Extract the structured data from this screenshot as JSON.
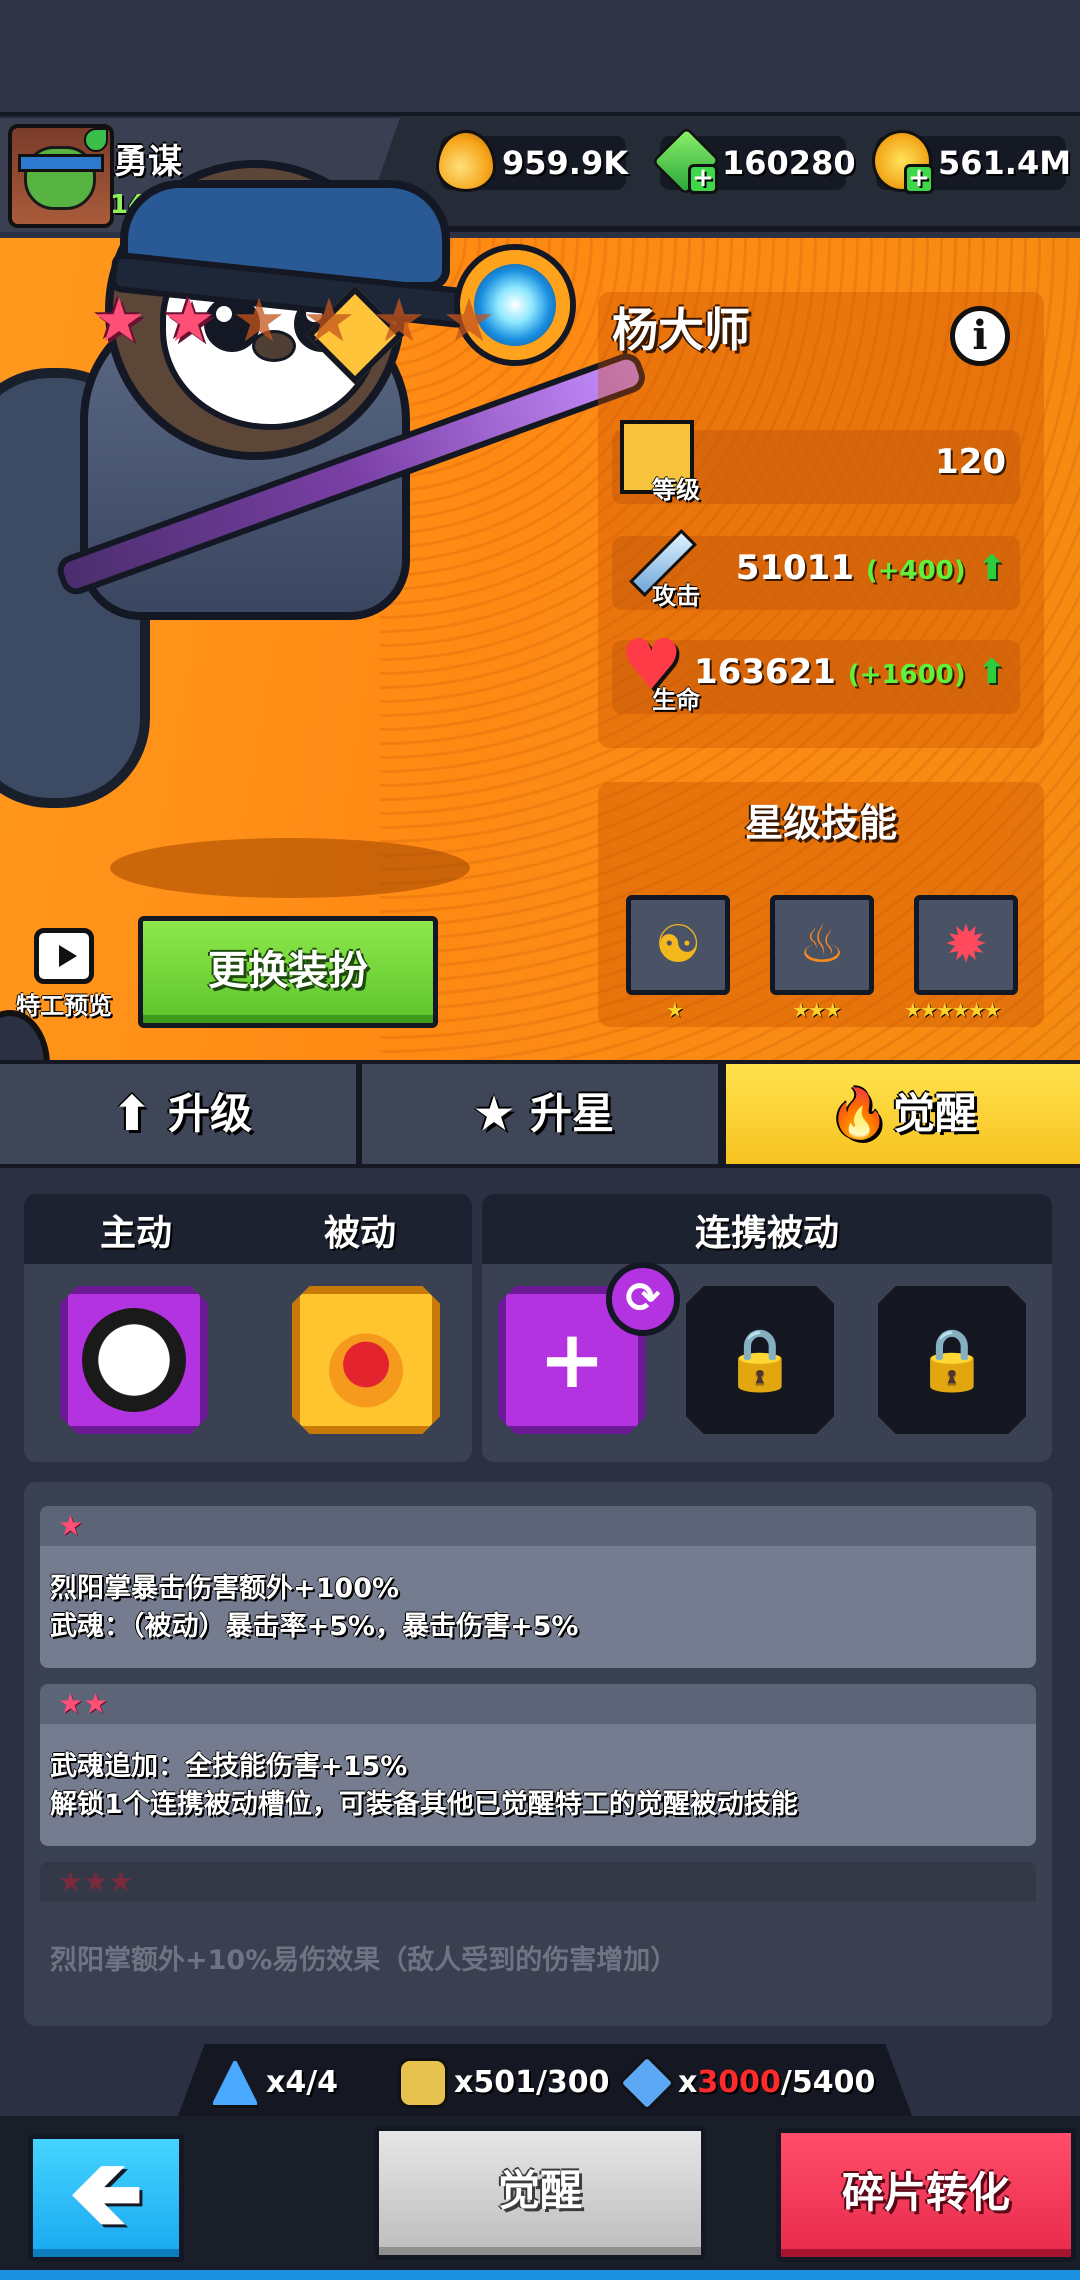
{
  "player": {
    "name": "勇谋",
    "level": "148",
    "xp_fraction": 0.5
  },
  "currencies": {
    "drops": "959.9K",
    "gems": "160280",
    "coins": "561.4M"
  },
  "hero": {
    "name": "杨大师",
    "stars_on": 2,
    "stars_total": 7,
    "stats": {
      "level_label": "等级",
      "level_value": "120",
      "attack_label": "攻击",
      "attack_value": "51011",
      "attack_bonus": "(+400)",
      "hp_label": "生命",
      "hp_value": "163621",
      "hp_bonus": "(+1600)"
    },
    "star_skills_title": "星级技能",
    "star_skills": [
      {
        "icon": "yin-yang-icon",
        "stars": "★"
      },
      {
        "icon": "fire-gourd-icon",
        "stars": "★★★"
      },
      {
        "icon": "fire-beast-icon",
        "stars": "★★★★★★"
      }
    ],
    "preview_label": "特工预览",
    "change_outfit_label": "更换装扮"
  },
  "tabs": [
    {
      "label": "升级",
      "icon": "arrow-up-icon",
      "active": false
    },
    {
      "label": "升星",
      "icon": "star-icon",
      "active": false
    },
    {
      "label": "觉醒",
      "icon": "flame-icon",
      "active": true
    }
  ],
  "skill_slots": {
    "active_title": "主动",
    "passive_title": "被动",
    "linked_title": "连携被动"
  },
  "awaken_levels": [
    {
      "stars": "★",
      "lines": [
        "烈阳掌暴击伤害额外+100%",
        "武魂：（被动）暴击率+5%，暴击伤害+5%"
      ],
      "unlocked": true
    },
    {
      "stars": "★★",
      "lines": [
        "武魂追加：全技能伤害+15%",
        "解锁1个连携被动槽位，可装备其他已觉醒特工的觉醒被动技能"
      ],
      "unlocked": true
    },
    {
      "stars": "★★★",
      "lines": [
        "烈阳掌额外+10%易伤效果（敌人受到的伤害增加）"
      ],
      "unlocked": false
    }
  ],
  "resources": {
    "res1": "x4/4",
    "res2": "x501/300",
    "res3_prefix": "x",
    "res3_have": "3000",
    "res3_need": "/5400"
  },
  "buttons": {
    "back": "🡸",
    "awaken": "觉醒",
    "shard_convert": "碎片转化"
  },
  "colors": {
    "accent_orange": "#ff9a1d",
    "active_tab": "#f7c321",
    "shortfall_red": "#ff2b2b"
  }
}
